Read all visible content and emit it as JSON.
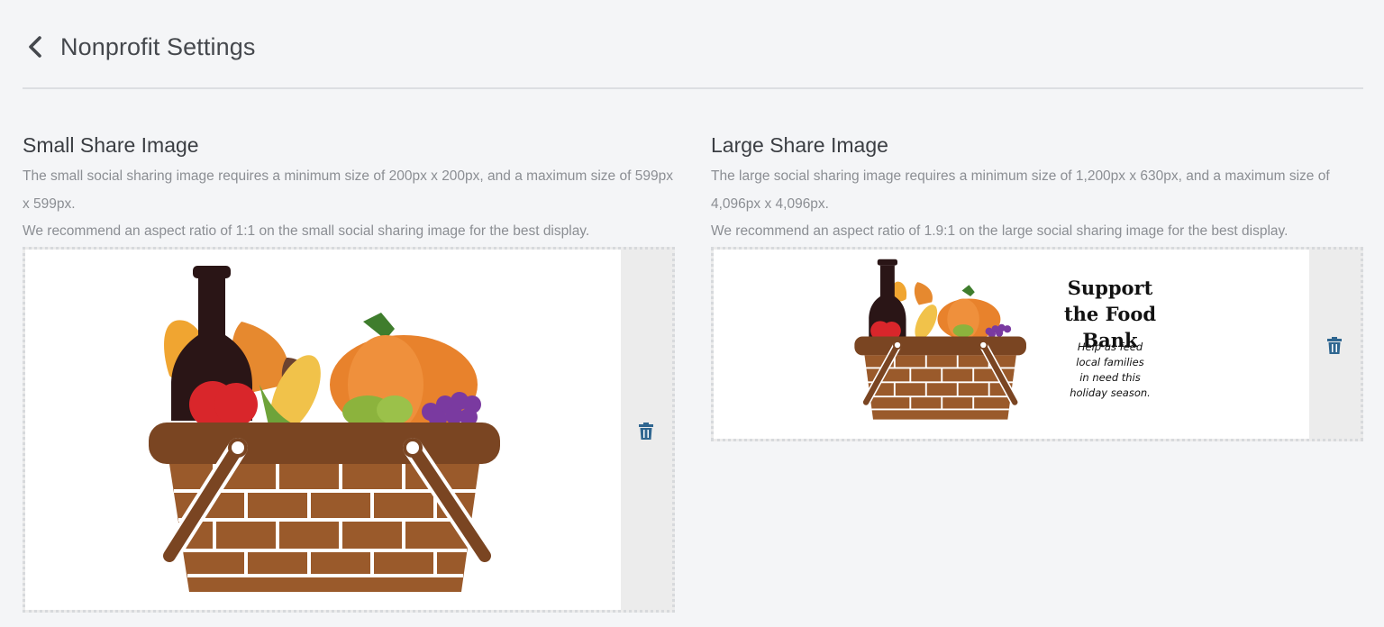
{
  "header": {
    "title": "Nonprofit Settings",
    "back_icon": "chevron-left-icon"
  },
  "small_share": {
    "title": "Small Share Image",
    "description_line1": "The small social sharing image requires a minimum size of 200px x 200px, and a maximum size of 599px x 599px.",
    "description_line2": "We recommend an aspect ratio of 1:1 on the small social sharing image for the best display.",
    "delete_icon": "trash-icon"
  },
  "large_share": {
    "title": "Large Share Image",
    "description_line1": "The large social sharing image requires a minimum size of 1,200px x 630px, and a maximum size of 4,096px x 4,096px.",
    "description_line2": "We recommend an aspect ratio of 1.9:1 on the large social sharing image for the best display.",
    "promo_title_line1": "Support",
    "promo_title_line2": "the Food Bank",
    "promo_sub_line1": "Help us feed",
    "promo_sub_line2": "local families",
    "promo_sub_line3": "in need this",
    "promo_sub_line4": "holiday season.",
    "delete_icon": "trash-icon"
  },
  "colors": {
    "accent_icon": "#2f6690",
    "background": "#f4f5f7",
    "basket_brown": "#7a4522",
    "basket_light": "#9a5a2b",
    "pumpkin": "#e8822c",
    "corn": "#f1c24a",
    "bottle": "#2a1516",
    "apple": "#d9262b",
    "grapes": "#7a3aa0",
    "leaf_orange": "#e6892f"
  }
}
